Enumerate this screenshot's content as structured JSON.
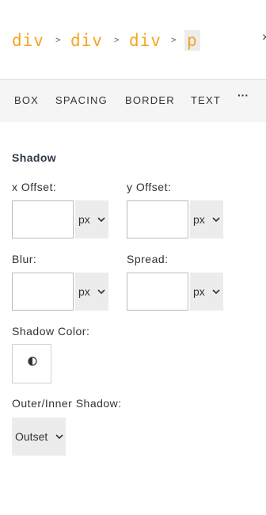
{
  "breadcrumb": {
    "items": [
      "div",
      "div",
      "div",
      "p"
    ],
    "separator": ">"
  },
  "close_glyph": "×",
  "tabs": {
    "items": [
      "BOX",
      "SPACING",
      "BORDER",
      "TEXT"
    ],
    "more_label": "···"
  },
  "shadow": {
    "title": "Shadow",
    "x_offset": {
      "label": "x Offset:",
      "value": "",
      "unit": "px"
    },
    "y_offset": {
      "label": "y Offset:",
      "value": "",
      "unit": "px"
    },
    "blur": {
      "label": "Blur:",
      "value": "",
      "unit": "px"
    },
    "spread": {
      "label": "Spread:",
      "value": "",
      "unit": "px"
    },
    "color": {
      "label": "Shadow Color:",
      "icon": "contrast-icon"
    },
    "mode": {
      "label": "Outer/Inner Shadow:",
      "value": "Outset"
    }
  },
  "colors": {
    "accent": "#f5a623",
    "tabs_bg": "#f5f5f5",
    "select_bg": "#ececec",
    "title": "#2d3a4a"
  }
}
